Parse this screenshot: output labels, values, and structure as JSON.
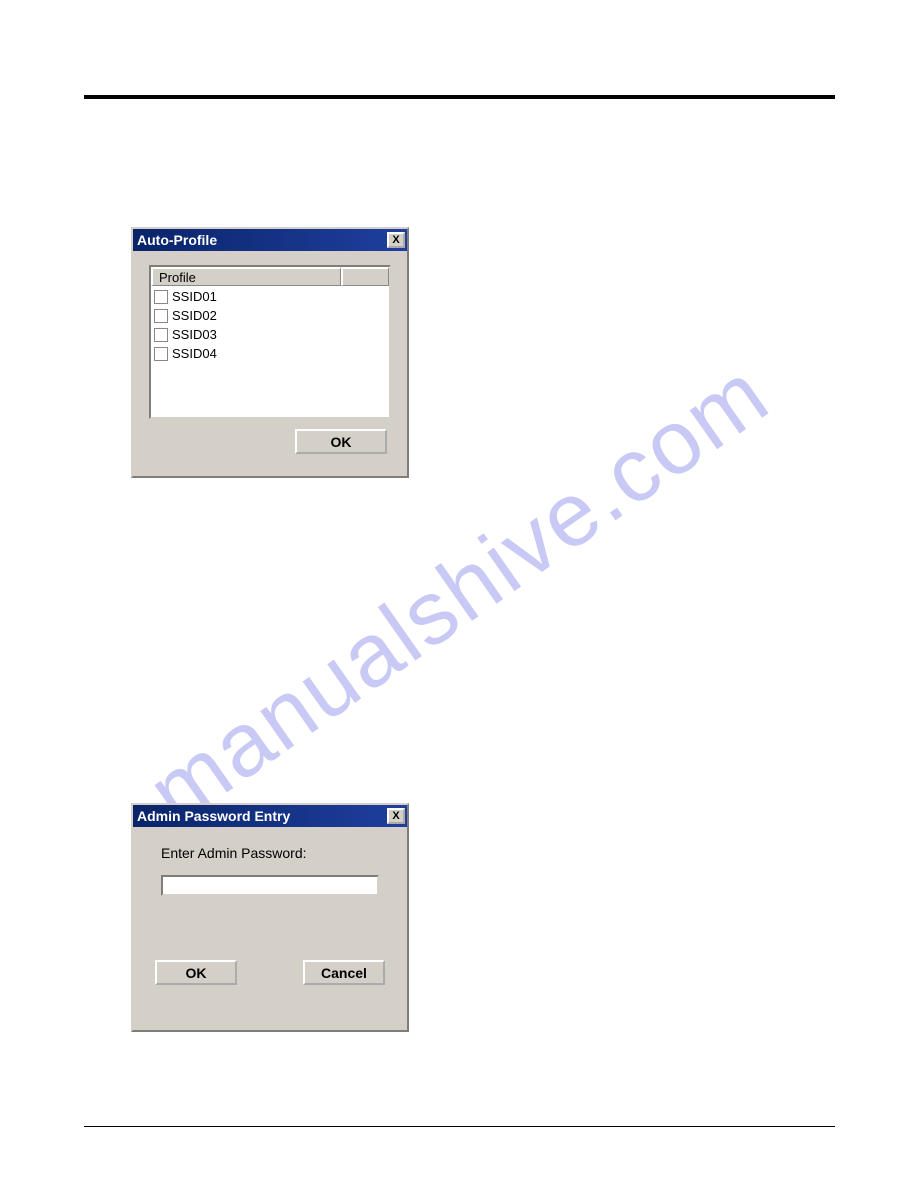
{
  "watermark": "manualshive.com",
  "auto_profile": {
    "title": "Auto-Profile",
    "close": "X",
    "header": "Profile",
    "items": [
      "SSID01",
      "SSID02",
      "SSID03",
      "SSID04"
    ],
    "ok": "OK"
  },
  "admin": {
    "title": "Admin Password Entry",
    "close": "X",
    "label": "Enter Admin Password:",
    "value": "",
    "ok": "OK",
    "cancel": "Cancel"
  }
}
